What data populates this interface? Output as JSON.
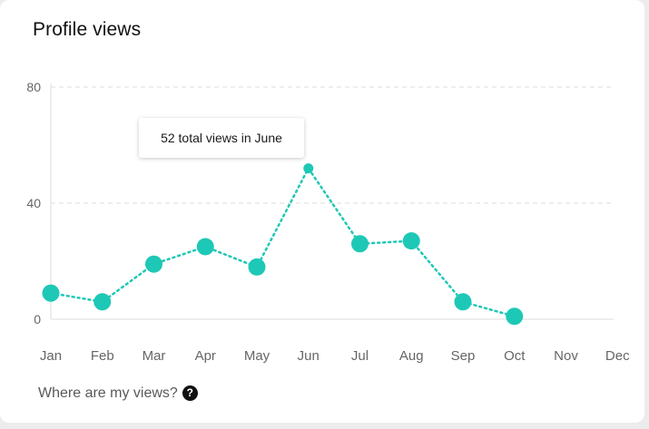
{
  "card": {
    "title": "Profile views"
  },
  "tooltip": {
    "text": "52 total views in June"
  },
  "help": {
    "label": "Where are my views?",
    "icon_glyph": "?",
    "icon_name": "question-circle-icon"
  },
  "colors": {
    "series": "#1ec8b6",
    "grid": "#dddddd",
    "axis_text": "#666666"
  },
  "chart_data": {
    "type": "line",
    "categories": [
      "Jan",
      "Feb",
      "Mar",
      "Apr",
      "May",
      "Jun",
      "Jul",
      "Aug",
      "Sep",
      "Oct",
      "Nov",
      "Dec"
    ],
    "values": [
      9,
      6,
      19,
      25,
      18,
      52,
      26,
      27,
      6,
      1,
      null,
      null
    ],
    "highlighted": "Jun",
    "yticks": [
      0,
      40,
      80
    ],
    "ylim": [
      0,
      80
    ],
    "grid": true,
    "line_style": "dotted",
    "title": "",
    "xlabel": "",
    "ylabel": ""
  }
}
